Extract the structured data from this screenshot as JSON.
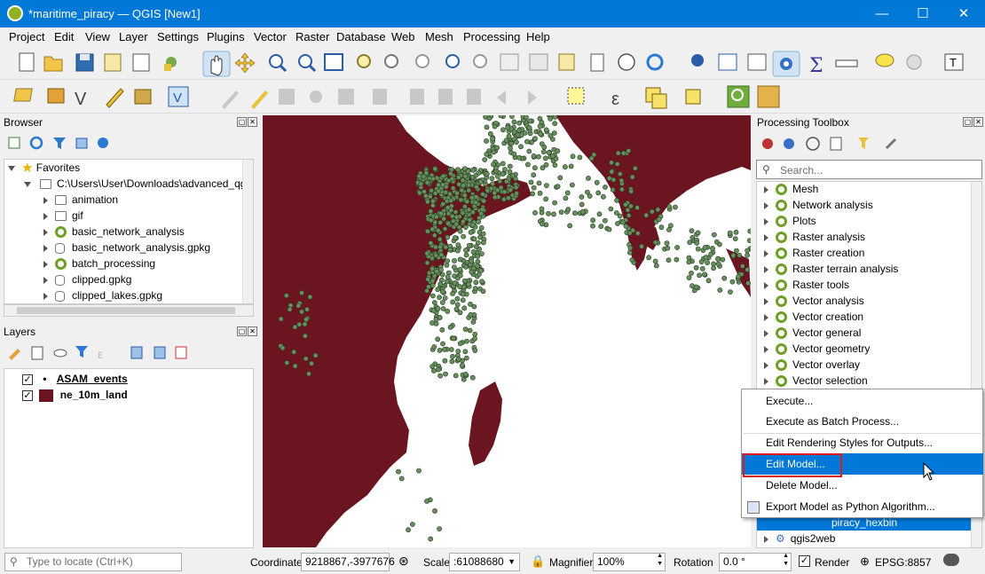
{
  "window": {
    "title": "*maritime_piracy — QGIS [New1]",
    "minimize": "—",
    "maximize": "☐",
    "close": "✕"
  },
  "menubar": [
    "Project",
    "Edit",
    "View",
    "Layer",
    "Settings",
    "Plugins",
    "Vector",
    "Raster",
    "Database",
    "Web",
    "Mesh",
    "Processing",
    "Help"
  ],
  "browser": {
    "title": "Browser",
    "items": [
      {
        "label": "Favorites",
        "icon": "star-icon"
      },
      {
        "label": "C:\\Users\\User\\Downloads\\advanced_qg",
        "icon": "folder-icon"
      },
      {
        "label": "animation",
        "icon": "folder-icon"
      },
      {
        "label": "gif",
        "icon": "folder-icon"
      },
      {
        "label": "basic_network_analysis",
        "icon": "qgis-icon"
      },
      {
        "label": "basic_network_analysis.gpkg",
        "icon": "database-icon"
      },
      {
        "label": "batch_processing",
        "icon": "qgis-icon"
      },
      {
        "label": "clipped.gpkg",
        "icon": "database-icon"
      },
      {
        "label": "clipped_lakes.gpkg",
        "icon": "database-icon"
      }
    ]
  },
  "layers": {
    "title": "Layers",
    "items": [
      {
        "label": "ASAM_events",
        "checked": "✓"
      },
      {
        "label": "ne_10m_land",
        "checked": "✓",
        "color": "#6b1521"
      }
    ]
  },
  "toolbox": {
    "title": "Processing Toolbox",
    "search_placeholder": "Search...",
    "items": [
      "Mesh",
      "Network analysis",
      "Plots",
      "Raster analysis",
      "Raster creation",
      "Raster terrain analysis",
      "Raster tools",
      "Vector analysis",
      "Vector creation",
      "Vector general",
      "Vector geometry",
      "Vector overlay",
      "Vector selection"
    ],
    "model_item": "piracy_hexbin",
    "plugin_item": "qgis2web"
  },
  "context_menu": {
    "items": [
      "Execute...",
      "Execute as Batch Process...",
      "Edit Rendering Styles for Outputs...",
      "Edit Model...",
      "Delete Model...",
      "Export Model as Python Algorithm..."
    ],
    "highlighted": "Edit Model..."
  },
  "statusbar": {
    "locate_placeholder": "Type to locate (Ctrl+K)",
    "coordinate_label": "Coordinate",
    "coordinate_value": "9218867,-3977676",
    "scale_label": "Scale",
    "scale_value": ":61088680",
    "magnifier_label": "Magnifier",
    "magnifier_value": "100%",
    "rotation_label": "Rotation",
    "rotation_value": "0.0 °",
    "render_label": "Render",
    "crs": "EPSG:8857"
  },
  "colors": {
    "land": "#6b1521",
    "points": "#6a8f5f",
    "accent": "#0078d7",
    "highlight_box": "#e0191c"
  }
}
